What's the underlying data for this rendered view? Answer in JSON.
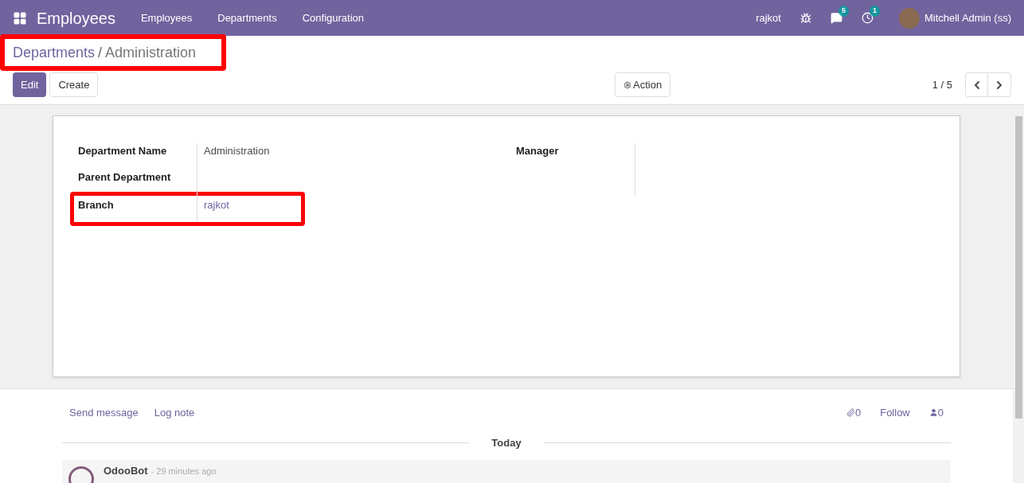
{
  "navbar": {
    "app_title": "Employees",
    "menu": [
      "Employees",
      "Departments",
      "Configuration"
    ],
    "company": "rajkot",
    "messages_count": "5",
    "activities_count": "1",
    "user": "Mitchell Admin (ss)"
  },
  "breadcrumb": {
    "parent": "Departments",
    "separator": "/",
    "current": "Administration",
    "highlighted": true
  },
  "buttons": {
    "edit": "Edit",
    "create": "Create",
    "action": "Action"
  },
  "pager": {
    "text": "1 / 5"
  },
  "form": {
    "left": [
      {
        "label": "Department Name",
        "value": "Administration",
        "highlighted": false
      },
      {
        "label": "Parent Department",
        "highlighted": false
      },
      {
        "label": "Branch",
        "value": "rajkot",
        "highlighted": true
      }
    ],
    "right": [
      {
        "label": "Manager"
      }
    ]
  },
  "chatter": {
    "send_message": "Send message",
    "log_note": "Log note",
    "attachments": "0",
    "follow": "Follow",
    "followers": "0",
    "divider": "Today",
    "message": {
      "author": "OdooBot",
      "time": "- 29 minutes ago"
    }
  }
}
